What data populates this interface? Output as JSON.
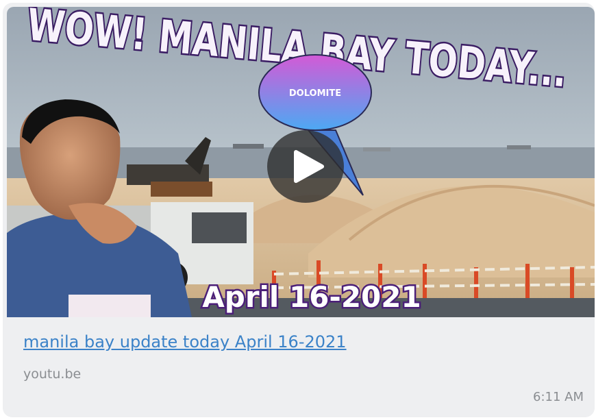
{
  "video": {
    "headline": "WOW! MANILA BAY TODAY...",
    "bubble_label": "DOLOMITE",
    "date_caption": "April 16-2021",
    "play_icon": "play-icon"
  },
  "link_preview": {
    "title": "manila bay update today April 16-2021",
    "domain": "youtu.be"
  },
  "message": {
    "time": "6:11 AM"
  },
  "colors": {
    "link": "#3b82c8",
    "meta_text": "#8a8d91",
    "card_bg": "#eeeff1",
    "headline_outline": "#3a1c63",
    "bubble_top": "#d05ad8",
    "bubble_bottom": "#4fa8f2"
  }
}
